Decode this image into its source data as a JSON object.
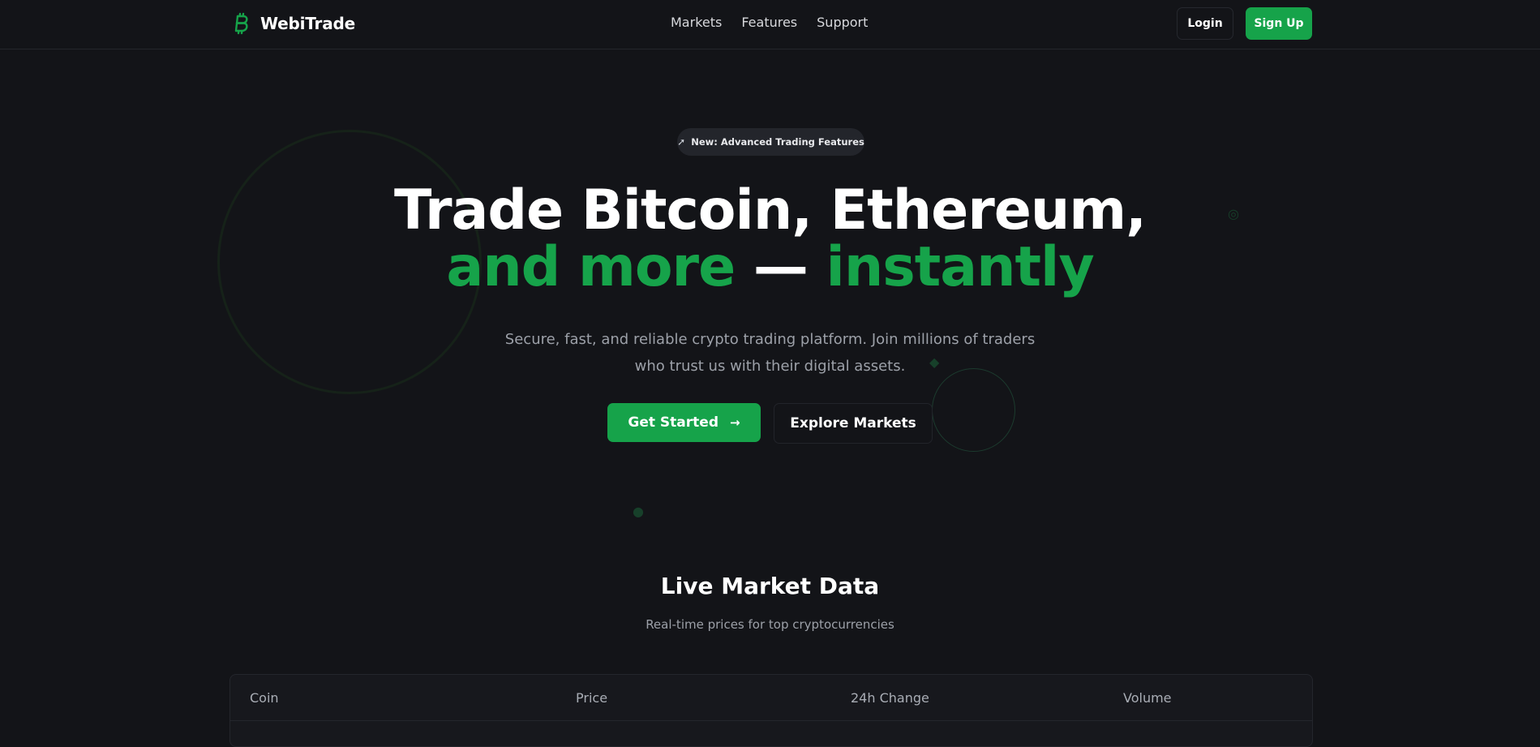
{
  "header": {
    "brand": "WebiTrade",
    "nav": [
      "Markets",
      "Features",
      "Support"
    ],
    "login_label": "Login",
    "signup_label": "Sign Up"
  },
  "hero": {
    "badge": "New: Advanced Trading Features",
    "title_line1": "Trade Bitcoin, Ethereum,",
    "title_line2_a": "and more",
    "title_line2_b": " — ",
    "title_line2_c": "instantly",
    "subtitle_line1": "Secure, fast, and reliable crypto trading platform. Join millions of traders",
    "subtitle_line2": "who trust us with their digital assets.",
    "cta_primary": "Get Started",
    "cta_secondary": "Explore Markets"
  },
  "market": {
    "title": "Live Market Data",
    "subtitle": "Real-time prices for top cryptocurrencies",
    "columns": [
      "Coin",
      "Price",
      "24h Change",
      "Volume"
    ]
  },
  "colors": {
    "background": "#131418",
    "accent": "#16a34a",
    "muted_text": "#9ca0a8"
  },
  "icons": {
    "brand": "bitcoin-icon",
    "badge": "rocket-icon",
    "cta": "arrow-right-icon"
  }
}
